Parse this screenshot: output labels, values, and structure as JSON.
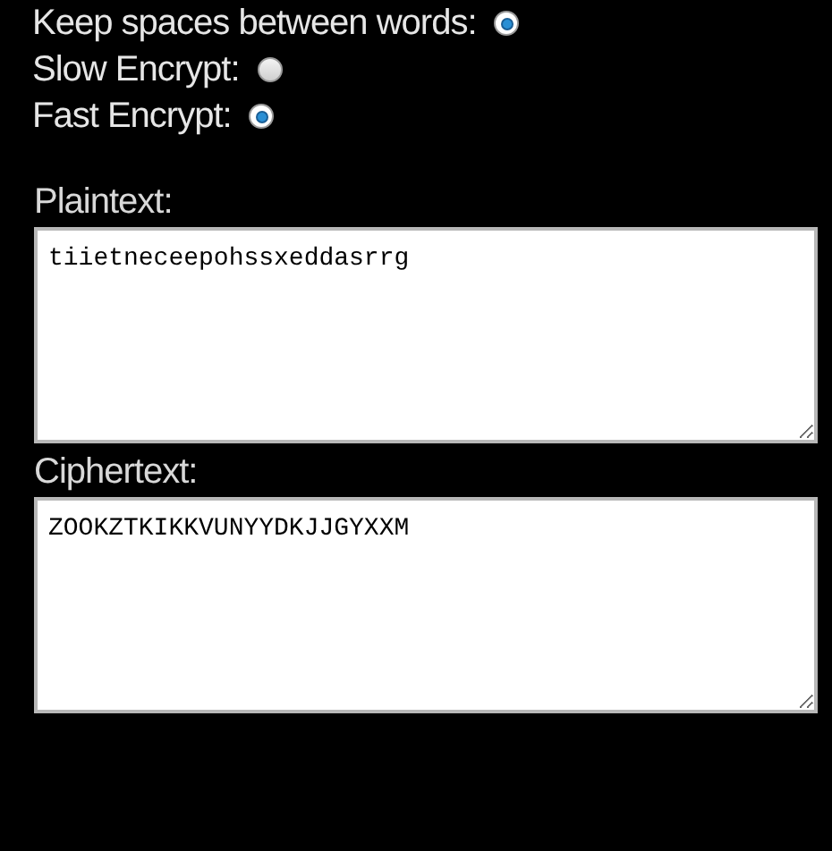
{
  "options": [
    {
      "label": "Keep spaces between words:",
      "checked": true
    },
    {
      "label": "Slow Encrypt:",
      "checked": false
    },
    {
      "label": "Fast Encrypt:",
      "checked": true
    }
  ],
  "fields": [
    {
      "label": "Plaintext:",
      "value": "tiietneceepohssxeddasrrg"
    },
    {
      "label": "Ciphertext:",
      "value": "ZOOKZTKIKKVUNYYDKJJGYXXM"
    }
  ]
}
